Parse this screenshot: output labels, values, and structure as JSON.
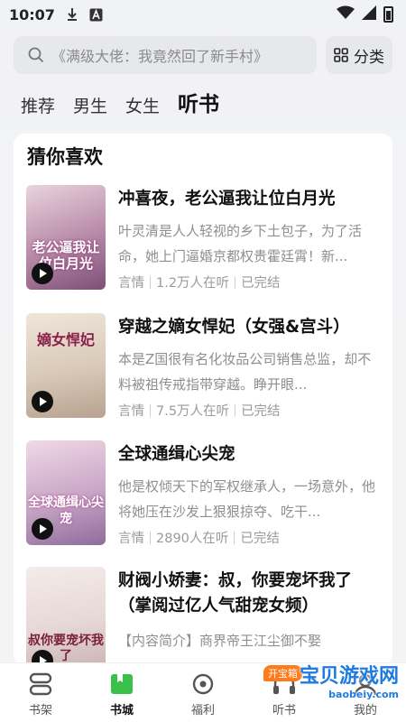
{
  "status_bar": {
    "time": "10:07"
  },
  "search": {
    "placeholder": "《满级大佬：我竟然回了新手村》"
  },
  "category_button": {
    "label": "分类"
  },
  "tabs": [
    {
      "label": "推荐"
    },
    {
      "label": "男生"
    },
    {
      "label": "女生"
    },
    {
      "label": "听书"
    }
  ],
  "section": {
    "title": "猜你喜欢"
  },
  "books": [
    {
      "title": "冲喜夜，老公逼我让位白月光",
      "desc": "叶灵清是人人轻视的乡下土包子，为了活命，她上门逼婚京都权贵霍廷霄！新...",
      "genre": "言情",
      "listeners": "1.2万人在听",
      "status": "已完结",
      "cover_text": "老公逼我让位白月光",
      "cover_color": "#b88aa8"
    },
    {
      "title": "穿越之嫡女悍妃（女强&宫斗）",
      "desc": "本是Z国很有名化妆品公司销售总监，却不料被祖传戒指带穿越。睁开眼...",
      "genre": "言情",
      "listeners": "7.5万人在听",
      "status": "已完结",
      "cover_text": "嫡女悍妃",
      "cover_color": "#d9c9b8"
    },
    {
      "title": "全球通缉心尖宠",
      "desc": "他是权倾天下的军权继承人，一场意外，他将她压在沙发上狠狠掠夺、吃干...",
      "genre": "言情",
      "listeners": "2890人在听",
      "status": "已完结",
      "cover_text": "全球通缉心尖宠",
      "cover_color": "#c8a6c6"
    },
    {
      "title": "财阀小娇妻：叔，你要宠坏我了（掌阅过亿人气甜宠女频）",
      "desc": "【内容简介】商界帝王江尘御不娶",
      "cover_text": "叔你要宠坏我了",
      "cover_color": "#e6d8d6"
    }
  ],
  "bottom_nav": [
    {
      "label": "书架"
    },
    {
      "label": "书城"
    },
    {
      "label": "福利"
    },
    {
      "label": "听书",
      "badge": "开宝箱"
    },
    {
      "label": "我的"
    }
  ],
  "watermark": {
    "text": "宝贝游戏网",
    "sub": "baobeiy.com"
  }
}
